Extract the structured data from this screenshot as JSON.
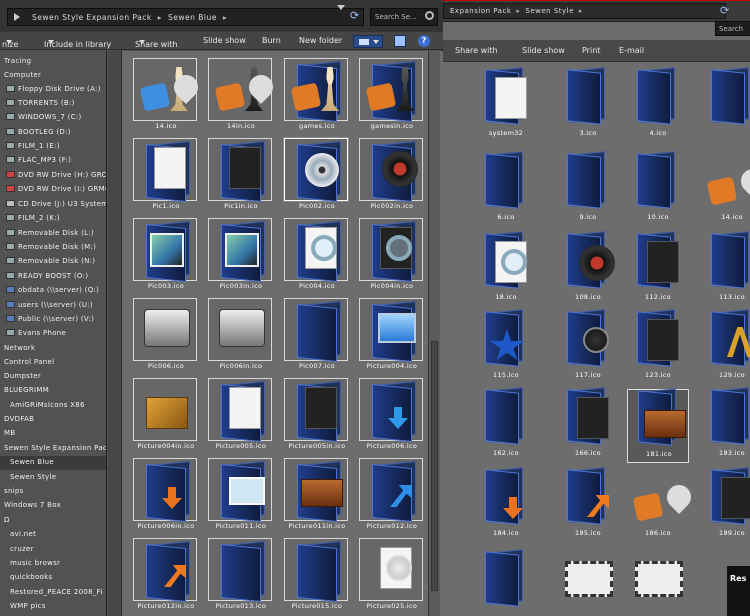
{
  "back_window": {
    "breadcrumb": [
      "Expansion Pack",
      "Sewen Style"
    ],
    "search_placeholder": "Search",
    "toolbar": [
      "Share with",
      "Slide show",
      "Print",
      "E-mail"
    ],
    "files": [
      {
        "label": "system32",
        "icon": "folder-doc"
      },
      {
        "label": "3.ico",
        "icon": "folder"
      },
      {
        "label": "4.ico",
        "icon": "folder"
      },
      {
        "label": "",
        "icon": "folder"
      },
      {
        "label": "6.ico",
        "icon": "folder"
      },
      {
        "label": "9.ico",
        "icon": "folder"
      },
      {
        "label": "10.ico",
        "icon": "folder"
      },
      {
        "label": "14.ico",
        "icon": "puzzle-orange"
      },
      {
        "label": "18.ico",
        "icon": "folder-mag"
      },
      {
        "label": "108.ico",
        "icon": "folder-vinyl"
      },
      {
        "label": "112.ico",
        "icon": "folder-film"
      },
      {
        "label": "113.ico",
        "icon": "folder"
      },
      {
        "label": "115.ico",
        "icon": "folder-star"
      },
      {
        "label": "117.ico",
        "icon": "folder-clock"
      },
      {
        "label": "123.ico",
        "icon": "folder-film"
      },
      {
        "label": "129.ico",
        "icon": "folder-a"
      },
      {
        "label": "162.ico",
        "icon": "folder"
      },
      {
        "label": "166.ico",
        "icon": "folder-list"
      },
      {
        "label": "181.ico",
        "icon": "folder-book"
      },
      {
        "label": "183.ico",
        "icon": "folder"
      },
      {
        "label": "184.ico",
        "icon": "folder-arrow"
      },
      {
        "label": "185.ico",
        "icon": "folder-curve"
      },
      {
        "label": "186.ico",
        "icon": "puzzle-orange"
      },
      {
        "label": "189.ico",
        "icon": "folder-film"
      },
      {
        "label": "",
        "icon": "folder"
      },
      {
        "label": "",
        "icon": "filmstrip"
      },
      {
        "label": "",
        "icon": "filmstrip"
      }
    ],
    "logo_text": "Res"
  },
  "front_window": {
    "breadcrumb": [
      "Sewen Style Expansion Pack",
      "Sewen Blue"
    ],
    "search_placeholder": "Search Se...",
    "toolbar": {
      "organize": "nize",
      "include": "Include in library",
      "share": "Share with",
      "slideshow": "Slide show",
      "burn": "Burn",
      "new_folder": "New folder",
      "help": "?"
    },
    "nav_items": [
      {
        "label": "Tracing",
        "icon": "none"
      },
      {
        "label": "Computer",
        "icon": "none"
      },
      {
        "label": "Floppy Disk Drive (A:)",
        "icon": "drive"
      },
      {
        "label": "TORRENTS (B:)",
        "icon": "drive"
      },
      {
        "label": "WINDOWS_7 (C:)",
        "icon": "drive"
      },
      {
        "label": "BOOTLEG (D:)",
        "icon": "drive"
      },
      {
        "label": "FILM_1 (E:)",
        "icon": "drive"
      },
      {
        "label": "FLAC_MP3 (F:)",
        "icon": "drive"
      },
      {
        "label": "DVD RW Drive (H:) GRC1C",
        "icon": "drive-red"
      },
      {
        "label": "DVD RW Drive (I:) GRMCU",
        "icon": "drive-red"
      },
      {
        "label": "CD Drive (J:) U3 System",
        "icon": "drive-grey"
      },
      {
        "label": "FILM_2 (K:)",
        "icon": "drive"
      },
      {
        "label": "Removable Disk (L:)",
        "icon": "drive"
      },
      {
        "label": "Removable Disk (M:)",
        "icon": "drive"
      },
      {
        "label": "Removable Disk (N:)",
        "icon": "drive"
      },
      {
        "label": "READY BOOST (O:)",
        "icon": "drive"
      },
      {
        "label": "obdata (\\\\server) (Q:)",
        "icon": "drive-net"
      },
      {
        "label": "users (\\\\server) (U:)",
        "icon": "drive-net"
      },
      {
        "label": "Public (\\\\server) (V:)",
        "icon": "drive-net"
      },
      {
        "label": "Evans Phone",
        "icon": "drive"
      },
      {
        "label": "Network",
        "icon": "none"
      },
      {
        "label": "Control Panel",
        "icon": "none"
      },
      {
        "label": "Dumpster",
        "icon": "none"
      },
      {
        "label": "BLUEGRIMM",
        "icon": "none"
      },
      {
        "label": "AmiGRiMsIcons X86",
        "icon": "none"
      },
      {
        "label": "DVDFAB",
        "icon": "none"
      },
      {
        "label": "MB",
        "icon": "none"
      },
      {
        "label": "Sewen Style Expansion Pac",
        "icon": "none"
      },
      {
        "label": "Sewen Blue",
        "icon": "none"
      },
      {
        "label": "Sewen Style",
        "icon": "none"
      },
      {
        "label": "snips",
        "icon": "none"
      },
      {
        "label": "Windows 7 Box",
        "icon": "none"
      },
      {
        "label": "Ω",
        "icon": "none"
      },
      {
        "label": "avi.net",
        "icon": "none"
      },
      {
        "label": "cruzer",
        "icon": "none"
      },
      {
        "label": "music browsr",
        "icon": "none"
      },
      {
        "label": "quickbooks",
        "icon": "none"
      },
      {
        "label": "Restored_PEACE 2008_Fi",
        "icon": "none"
      },
      {
        "label": "WMP pics",
        "icon": "none"
      }
    ],
    "selected_nav_index": 28,
    "files": [
      {
        "label": "14.ico",
        "icon": "chess-light"
      },
      {
        "label": "14in.ico",
        "icon": "chess-dark"
      },
      {
        "label": "games.ico",
        "icon": "folder-pawn"
      },
      {
        "label": "gamesin.ico",
        "icon": "folder-pawn-dark"
      },
      {
        "label": "Pic1.ico",
        "icon": "folder-doc"
      },
      {
        "label": "Pic1in.ico",
        "icon": "folder-film"
      },
      {
        "label": "Pic002.ico",
        "icon": "folder-cd"
      },
      {
        "label": "Pic002in.ico",
        "icon": "folder-vinyl"
      },
      {
        "label": "Pic003.ico",
        "icon": "folder-photo"
      },
      {
        "label": "Pic003in.ico",
        "icon": "folder-photo-dark"
      },
      {
        "label": "Pic004.ico",
        "icon": "folder-mag"
      },
      {
        "label": "Pic004in.ico",
        "icon": "folder-mag-dark"
      },
      {
        "label": "Pic006.ico",
        "icon": "projector"
      },
      {
        "label": "Pic006in.ico",
        "icon": "projector-dark"
      },
      {
        "label": "Pic007.ico",
        "icon": "folder"
      },
      {
        "label": "Picture004.ico",
        "icon": "folder-screen"
      },
      {
        "label": "Picture004in.ico",
        "icon": "box-gold"
      },
      {
        "label": "Picture005.ico",
        "icon": "folder-doc"
      },
      {
        "label": "Picture005in.ico",
        "icon": "folder-film"
      },
      {
        "label": "Picture006.ico",
        "icon": "folder-arrow-blue"
      },
      {
        "label": "Picture006in.ico",
        "icon": "folder-arrow-orange"
      },
      {
        "label": "Picture011.ico",
        "icon": "folder-card"
      },
      {
        "label": "Picture011in.ico",
        "icon": "folder-book"
      },
      {
        "label": "Picture012.ico",
        "icon": "folder-curve-blue"
      },
      {
        "label": "Picture012in.ico",
        "icon": "folder-curve-orange"
      },
      {
        "label": "Picture013.ico",
        "icon": "folder"
      },
      {
        "label": "Picture015.ico",
        "icon": "folder"
      },
      {
        "label": "Picture025.ico",
        "icon": "doc-clock"
      }
    ],
    "selected_file_index": 6
  }
}
